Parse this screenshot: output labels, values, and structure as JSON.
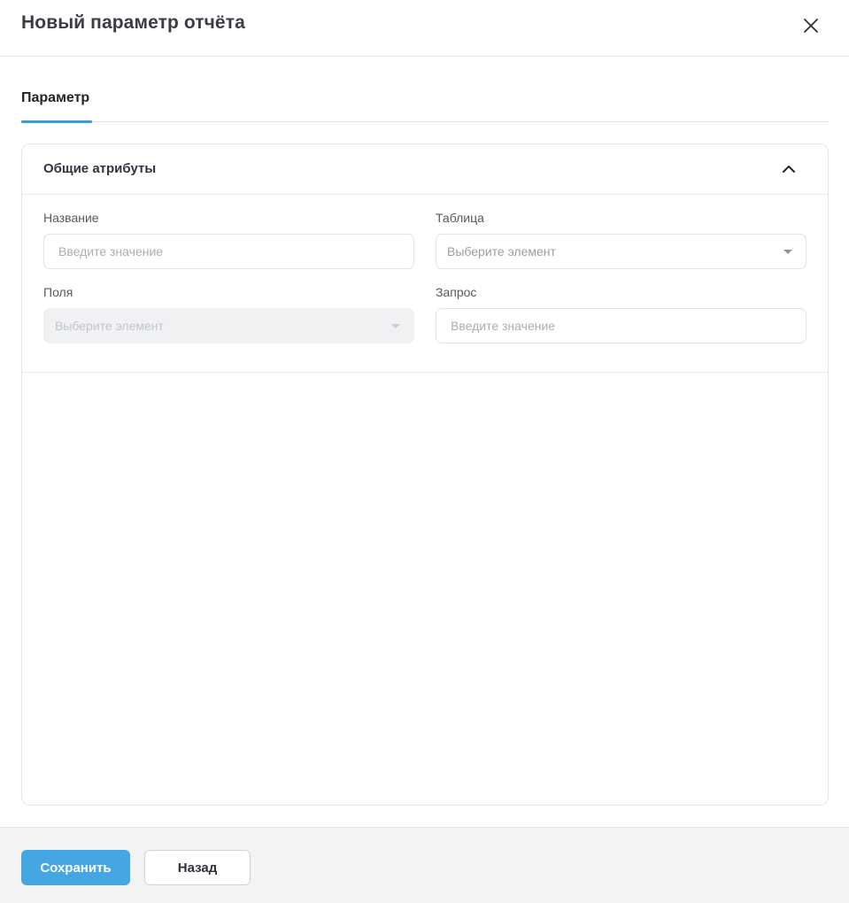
{
  "dialog": {
    "title": "Новый параметр отчёта",
    "close_icon": "close-icon"
  },
  "tabs": [
    {
      "label": "Параметр",
      "active": true
    }
  ],
  "section": {
    "title": "Общие атрибуты",
    "expanded": true,
    "toggle_icon": "chevron-up-icon"
  },
  "fields": {
    "name": {
      "label": "Название",
      "placeholder": "Введите значение",
      "value": ""
    },
    "table": {
      "label": "Таблица",
      "placeholder": "Выберите элемент",
      "value": ""
    },
    "fields_select": {
      "label": "Поля",
      "placeholder": "Выберите элемент",
      "value": "",
      "disabled": true
    },
    "query": {
      "label": "Запрос",
      "placeholder": "Введите значение",
      "value": ""
    }
  },
  "footer": {
    "save_label": "Сохранить",
    "back_label": "Назад"
  },
  "colors": {
    "accent": "#44a7e3",
    "tab_underline": "#3d9ad6",
    "border": "#e2e5ea",
    "footer_bg": "#f3f3f4",
    "disabled_bg": "#f0f1f3"
  }
}
